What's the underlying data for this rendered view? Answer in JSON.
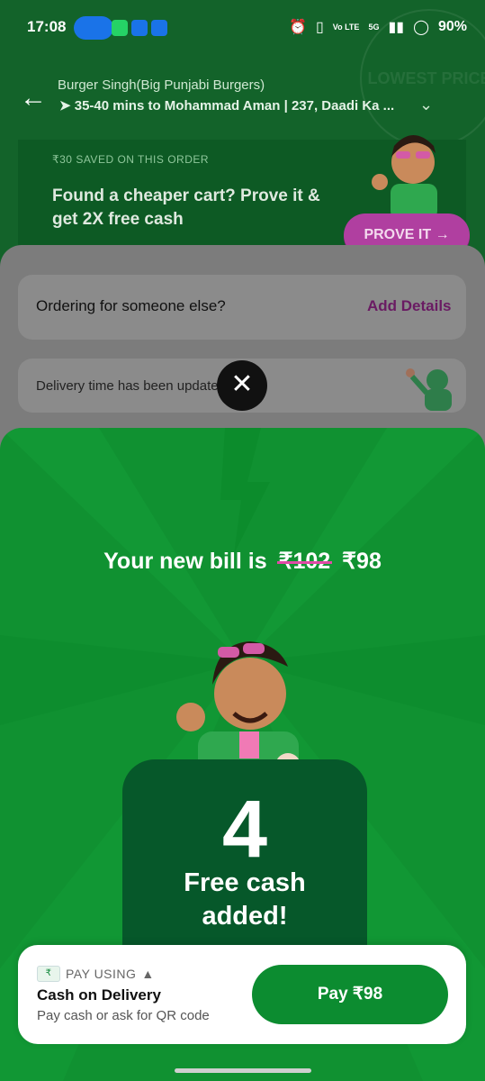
{
  "status_bar": {
    "time": "17:08",
    "volte": "Vo LTE",
    "network": "5G",
    "battery": "90%"
  },
  "header": {
    "restaurant": "Burger Singh(Big Punjabi Burgers)",
    "delivery_line": "35-40 mins to Mohammad Aman | 237, Daadi Ka ...",
    "stamp_text": "LOWEST PRICE"
  },
  "promo": {
    "saved": "₹30 SAVED ON THIS ORDER",
    "message": "Found a cheaper cart? Prove it & get 2X free cash",
    "button": "PROVE IT →"
  },
  "order_for": {
    "text": "Ordering for someone else?",
    "action": "Add Details"
  },
  "delivery_notice": "Delivery time has been update",
  "modal": {
    "bill_prefix": "Your new bill is",
    "old_price": "₹102",
    "new_price": "₹98",
    "amount": "4",
    "caption_line1": "Free cash",
    "caption_line2": "added!"
  },
  "pay": {
    "label": "PAY USING",
    "method": "Cash on Delivery",
    "hint": "Pay cash or ask for QR code",
    "button": "Pay ₹98"
  },
  "colors": {
    "modal_bg": "#109131",
    "pay_button": "#0c8c30",
    "prove_button": "#b03fa0",
    "strike": "#e04aa6"
  }
}
